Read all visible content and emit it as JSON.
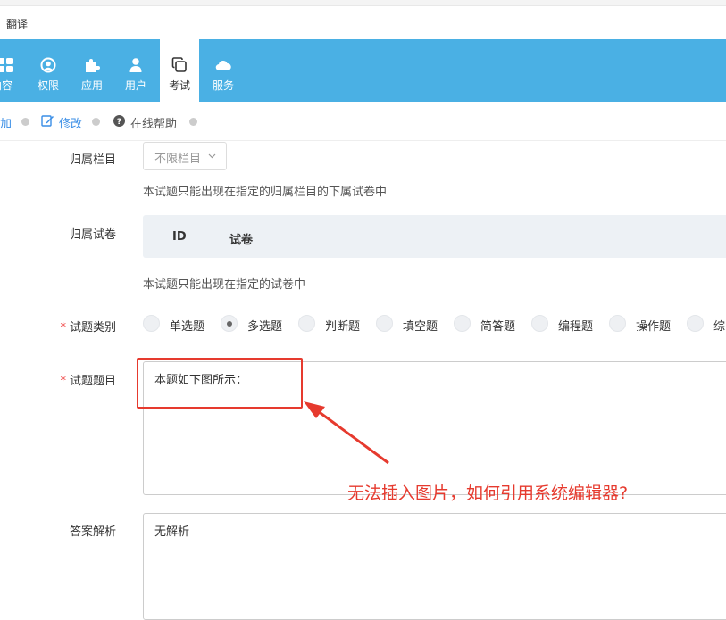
{
  "window": {
    "title": "翻译"
  },
  "nav": {
    "items": [
      {
        "label": "内容",
        "icon": "grid-icon"
      },
      {
        "label": "权限",
        "icon": "user-circle-icon"
      },
      {
        "label": "应用",
        "icon": "puzzle-icon"
      },
      {
        "label": "用户",
        "icon": "user-icon"
      },
      {
        "label": "考试",
        "icon": "copy-icon",
        "active": true
      },
      {
        "label": "服务",
        "icon": "cloud-icon"
      }
    ]
  },
  "toolbar": {
    "add_label": "加",
    "edit_label": "修改",
    "help_label": "在线帮助"
  },
  "form": {
    "category": {
      "label": "归属栏目",
      "select_value": "不限栏目",
      "hint": "本试题只能出现在指定的归属栏目的下属试卷中"
    },
    "paper": {
      "label": "归属试卷",
      "columns": [
        "ID",
        "试卷"
      ],
      "hint": "本试题只能出现在指定的试卷中"
    },
    "type": {
      "required": "*",
      "label": "试题类别",
      "options": [
        "单选题",
        "多选题",
        "判断题",
        "填空题",
        "简答题",
        "编程题",
        "操作题",
        "综"
      ],
      "selected": "多选题"
    },
    "question": {
      "required": "*",
      "label": "试题题目",
      "value": "本题如下图所示："
    },
    "analysis": {
      "label": "答案解析",
      "value": "无解析"
    }
  },
  "annotation": {
    "text": "无法插入图片，如何引用系统编辑器?",
    "color": "#e63a2e"
  },
  "colors": {
    "nav_bg": "#4ab0e4",
    "link": "#3a8ee6"
  }
}
